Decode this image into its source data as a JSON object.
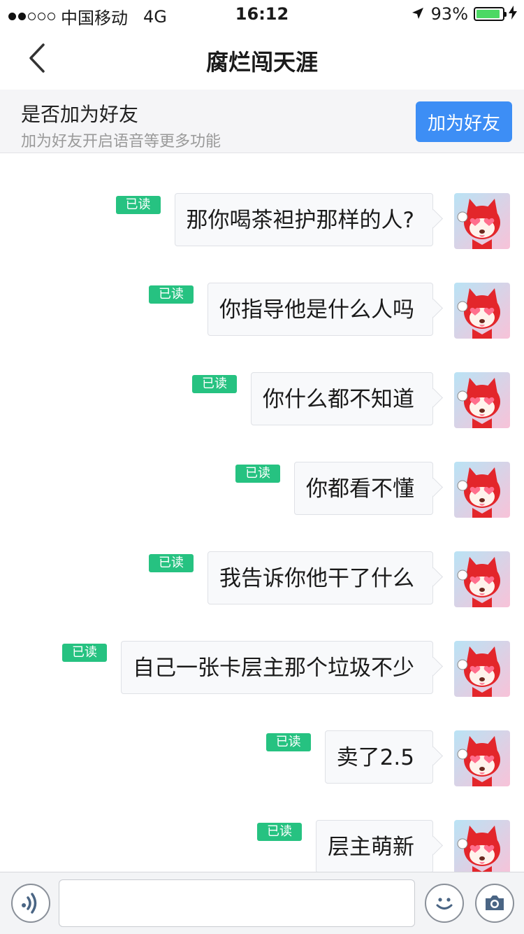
{
  "status_bar": {
    "carrier": "中国移动",
    "network": "4G",
    "time": "16:12",
    "battery": "93%",
    "battery_level": 0.93,
    "signal_dots_filled": 2,
    "signal_dots_total": 5
  },
  "nav": {
    "title": "腐烂闯天涯",
    "back_icon": "chevron-left-icon"
  },
  "friend_banner": {
    "title": "是否加为好友",
    "subtitle": "加为好友开启语音等更多功能",
    "button_label": "加为好友",
    "button_color": "#3d8ef5"
  },
  "messages": [
    {
      "text": "那你喝茶袒护那样的人?",
      "status": "已读"
    },
    {
      "text": "你指导他是什么人吗",
      "status": "已读"
    },
    {
      "text": "你什么都不知道",
      "status": "已读"
    },
    {
      "text": "你都看不懂",
      "status": "已读"
    },
    {
      "text": "我告诉你他干了什么",
      "status": "已读"
    },
    {
      "text": "自己一张卡层主那个垃圾不少",
      "status": "已读"
    },
    {
      "text": "卖了2.5",
      "status": "已读"
    },
    {
      "text": "层主萌新",
      "status": "已读"
    }
  ],
  "read_badge_color": "#26c281",
  "avatar_icon": "red-fox-avatar-icon",
  "input_bar": {
    "voice_icon": "voice-icon",
    "input_value": "",
    "emoji_icon": "smiley-icon",
    "camera_icon": "camera-icon"
  }
}
